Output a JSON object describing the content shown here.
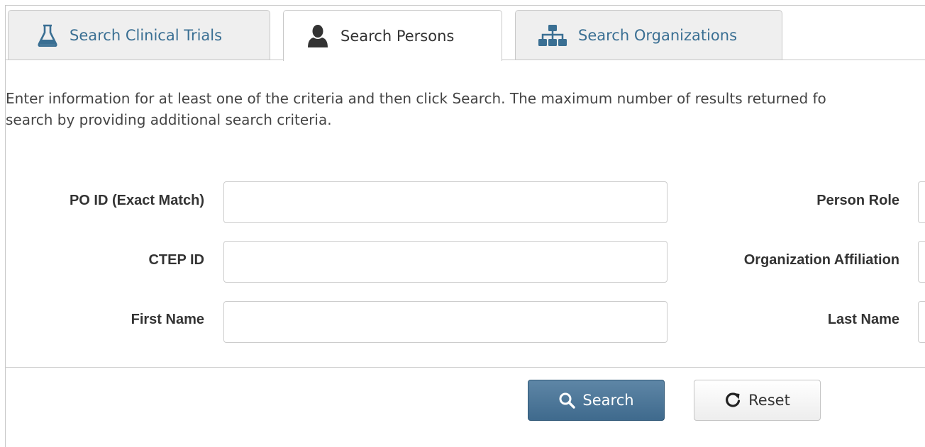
{
  "tabs": {
    "trials": {
      "label": "Search Clinical Trials",
      "icon": "flask-icon"
    },
    "persons": {
      "label": "Search Persons",
      "icon": "person-icon"
    },
    "orgs": {
      "label": "Search Organizations",
      "icon": "sitemap-icon"
    }
  },
  "instructions": {
    "line1": "Enter information for at least one of the criteria and then click Search. The maximum number of results returned fo",
    "line2": "search by providing additional search criteria."
  },
  "form": {
    "po_id_label": "PO ID (Exact Match)",
    "ctep_id_label": "CTEP ID",
    "first_name_label": "First Name",
    "person_role_label": "Person Role",
    "org_affiliation_label": "Organization Affiliation",
    "last_name_label": "Last Name",
    "po_id_value": "",
    "ctep_id_value": "",
    "first_name_value": ""
  },
  "buttons": {
    "search_label": "Search",
    "reset_label": "Reset"
  },
  "colors": {
    "link_blue": "#3a6f93",
    "primary_button": "#4a7597"
  }
}
